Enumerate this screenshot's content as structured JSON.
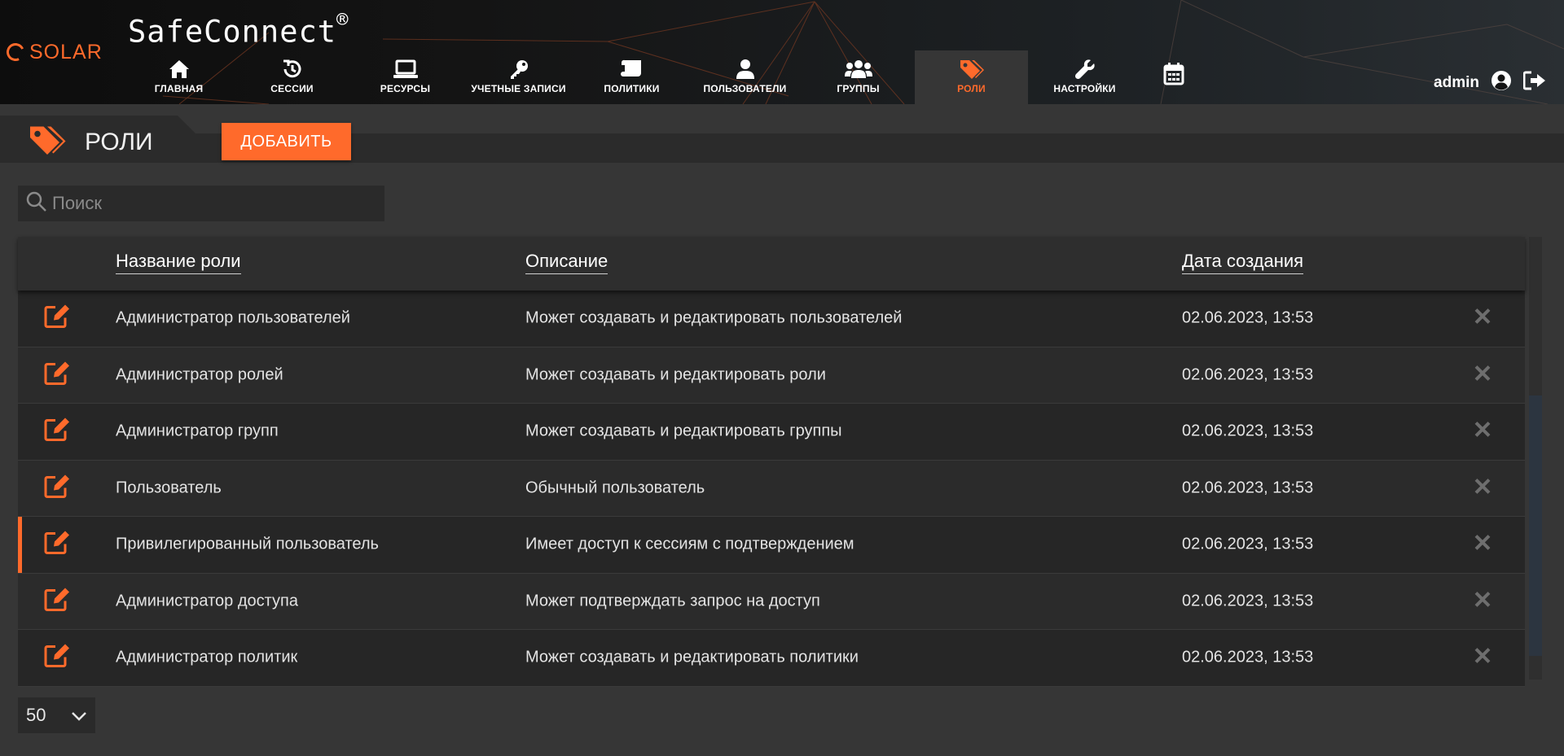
{
  "app": {
    "logo_text": "SOLAR",
    "title": "SafeConnect",
    "title_mark": "®"
  },
  "nav": {
    "items": [
      {
        "label": "ГЛАВНАЯ",
        "icon": "home-icon"
      },
      {
        "label": "СЕССИИ",
        "icon": "history-icon"
      },
      {
        "label": "РЕСУРСЫ",
        "icon": "laptop-icon"
      },
      {
        "label": "УЧЕТНЫЕ ЗАПИСИ",
        "icon": "key-icon"
      },
      {
        "label": "ПОЛИТИКИ",
        "icon": "scroll-icon"
      },
      {
        "label": "ПОЛЬЗОВАТЕЛИ",
        "icon": "user-icon"
      },
      {
        "label": "ГРУППЫ",
        "icon": "users-icon"
      },
      {
        "label": "РОЛИ",
        "icon": "tags-icon",
        "active": true
      },
      {
        "label": "НАСТРОЙКИ",
        "icon": "wrench-icon"
      }
    ],
    "calendar_icon": "calendar-icon"
  },
  "user": {
    "name": "admin"
  },
  "page": {
    "title": "РОЛИ",
    "add_label": "ДОБАВИТЬ"
  },
  "search": {
    "placeholder": "Поиск",
    "value": ""
  },
  "table": {
    "columns": [
      "Название роли",
      "Описание",
      "Дата создания"
    ],
    "rows": [
      {
        "name": "Администратор пользователей",
        "description": "Может создавать и редактировать пользователей",
        "created": "02.06.2023, 13:53"
      },
      {
        "name": "Администратор ролей",
        "description": "Может создавать и редактировать роли",
        "created": "02.06.2023, 13:53"
      },
      {
        "name": "Администратор групп",
        "description": "Может создавать и редактировать группы",
        "created": "02.06.2023, 13:53"
      },
      {
        "name": "Пользователь",
        "description": "Обычный пользователь",
        "created": "02.06.2023, 13:53"
      },
      {
        "name": "Привилегированный пользователь",
        "description": "Имеет доступ к сессиям с подтверждением",
        "created": "02.06.2023, 13:53",
        "highlight": true
      },
      {
        "name": "Администратор доступа",
        "description": "Может подтверждать запрос на доступ",
        "created": "02.06.2023, 13:53"
      },
      {
        "name": "Администратор политик",
        "description": "Может создавать и редактировать политики",
        "created": "02.06.2023, 13:53"
      }
    ]
  },
  "pagination": {
    "per_page": "50"
  },
  "colors": {
    "accent": "#ff6a2b",
    "background": "#363636",
    "header": "#141414"
  }
}
